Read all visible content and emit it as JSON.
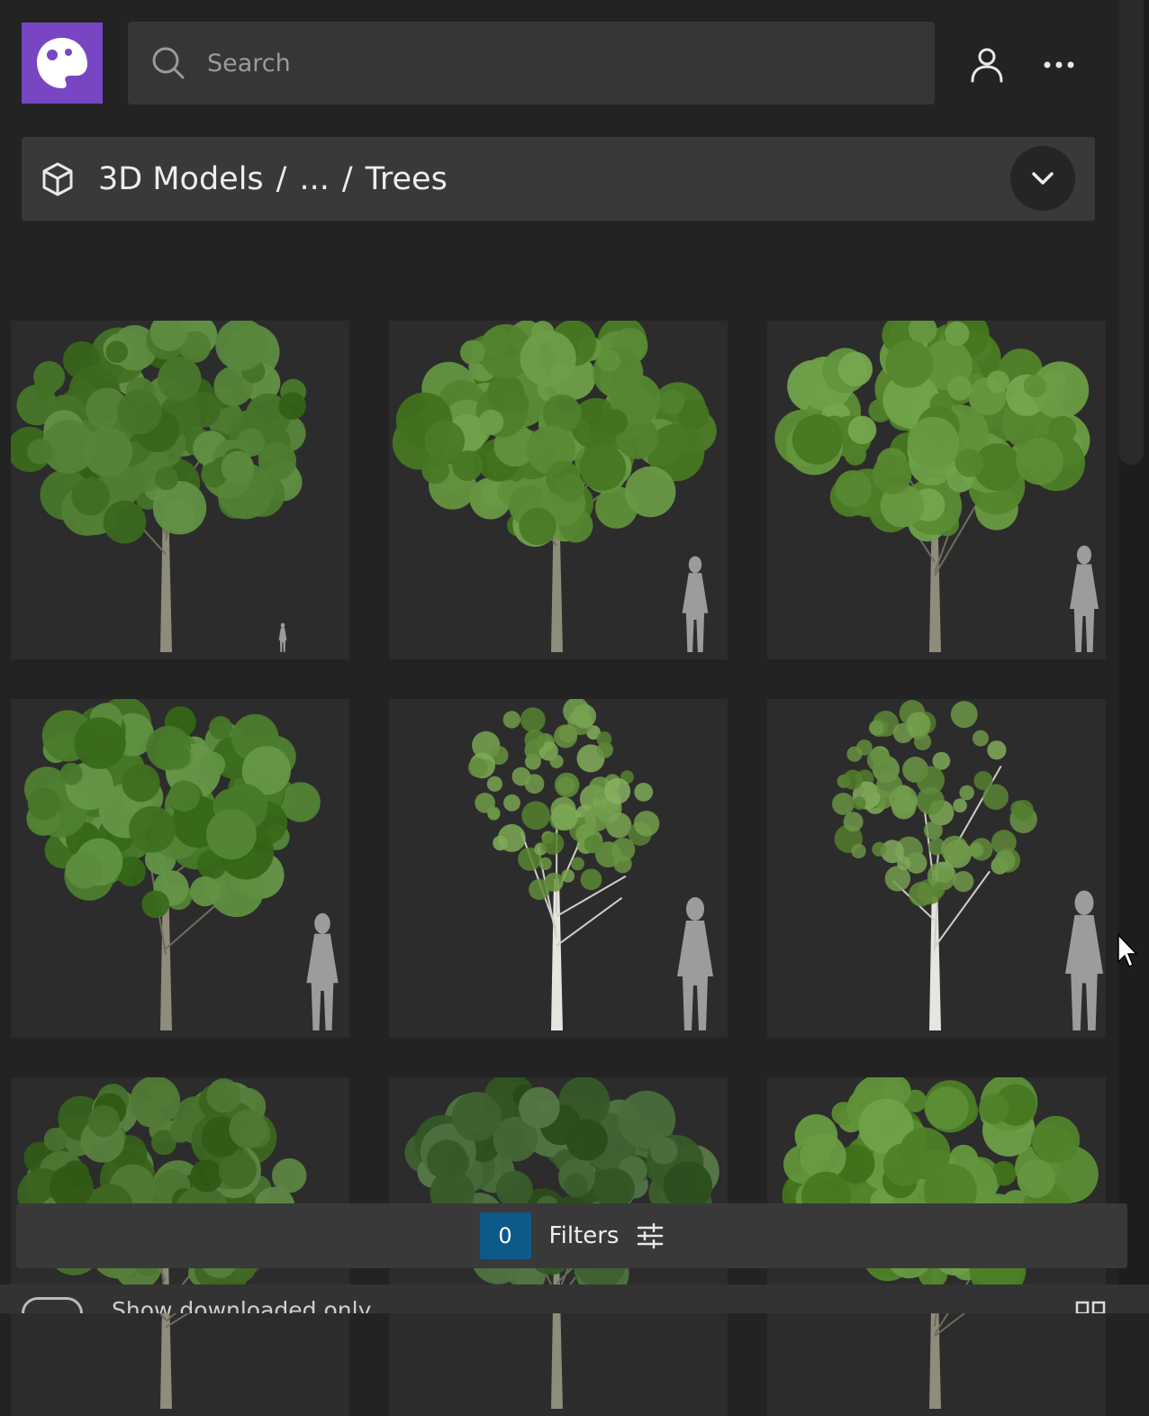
{
  "search": {
    "placeholder": "Search"
  },
  "breadcrumb": {
    "items": [
      "3D Models",
      "/",
      "...",
      "/",
      "Trees"
    ]
  },
  "grid": {
    "cards": [
      {
        "trunk": "bark",
        "foliage": "#4c7a2f"
      },
      {
        "trunk": "bark",
        "foliage": "#5a8a35"
      },
      {
        "trunk": "bark",
        "foliage": "#5f9038"
      },
      {
        "trunk": "bark",
        "foliage": "#4e7f30"
      },
      {
        "trunk": "birch",
        "foliage": "#6f9a48"
      },
      {
        "trunk": "birch",
        "foliage": "#6a9444"
      },
      {
        "trunk": "bark",
        "foliage": "#466f2b"
      },
      {
        "trunk": "bark",
        "foliage": "#3f6130"
      },
      {
        "trunk": "bark",
        "foliage": "#588a32"
      }
    ]
  },
  "filters": {
    "count": "0",
    "label": "Filters"
  },
  "bottom": {
    "toggle_label": "Show downloaded only"
  },
  "colors": {
    "brand": "#7846c2",
    "badge": "#0d5a8a"
  }
}
